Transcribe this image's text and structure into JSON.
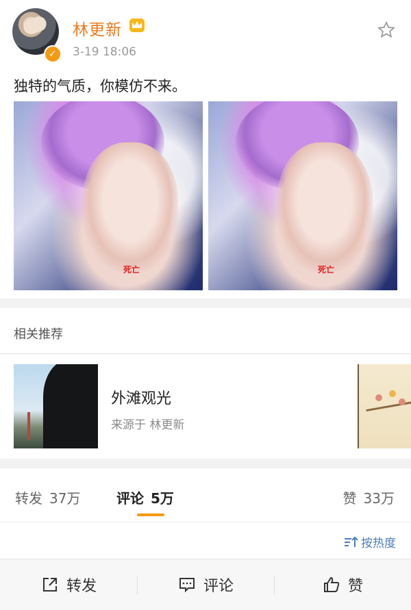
{
  "post": {
    "username": "林更新",
    "timestamp": "3-19  18:06",
    "text": "独特的气质，你模仿不来。",
    "images": [
      {
        "tag": "死亡"
      },
      {
        "tag": "死亡"
      }
    ]
  },
  "recommend": {
    "section_title": "相关推荐",
    "items": [
      {
        "title": "外滩观光",
        "source": "来源于  林更新"
      }
    ]
  },
  "stats": {
    "repost_label": "转发",
    "repost_count": "37万",
    "comment_label": "评论",
    "comment_count": "5万",
    "like_label": "赞",
    "like_count": "33万",
    "sort_label": "按热度"
  },
  "bottom_bar": {
    "repost": "转发",
    "comment": "评论",
    "like": "赞"
  },
  "colors": {
    "accent": "#f59a12",
    "username": "#ea7a1d",
    "link": "#4a7fb8"
  }
}
